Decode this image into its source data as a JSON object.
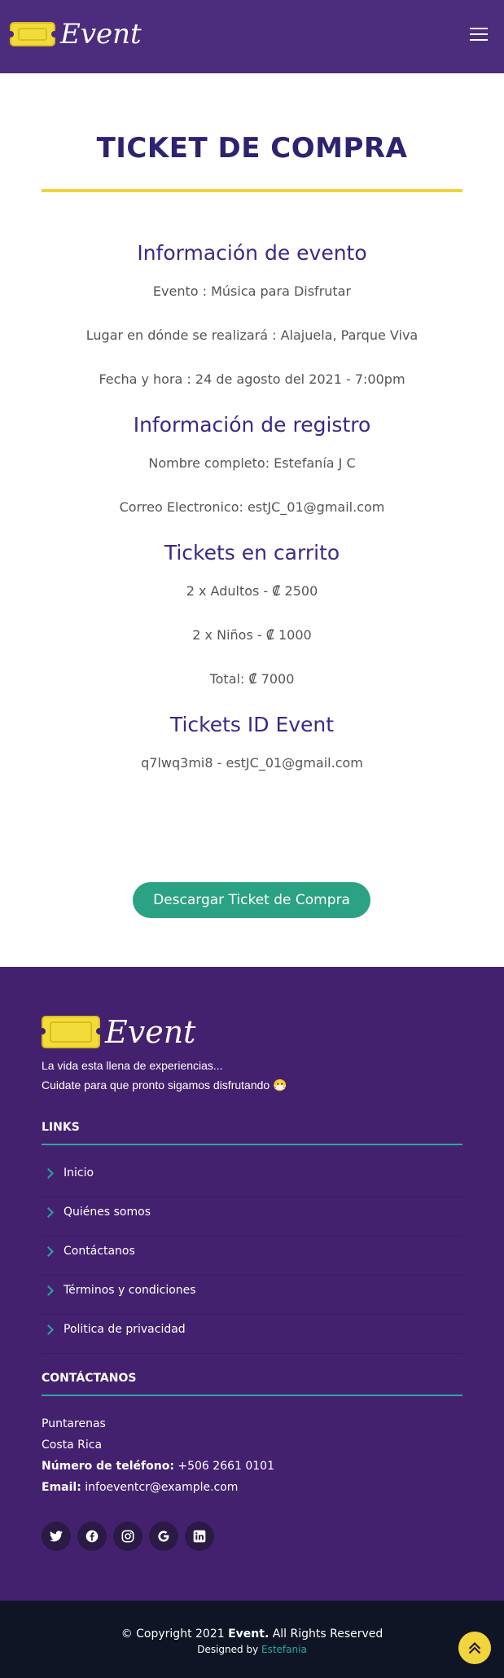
{
  "header": {
    "logo_text": "Event",
    "menu_icon": "hamburger-menu-icon"
  },
  "main": {
    "title": "TICKET DE COMPRA",
    "event_info": {
      "heading": "Información de evento",
      "event": "Evento : Música para Disfrutar",
      "place": "Lugar en dónde se realizará : Alajuela, Parque Viva",
      "datetime": "Fecha y hora : 24 de agosto del 2021 - 7:00pm"
    },
    "registration": {
      "heading": "Información de registro",
      "name": "Nombre completo: Estefanía J C",
      "email": "Correo Electronico: estJC_01@gmail.com"
    },
    "cart": {
      "heading": "Tickets en carrito",
      "adults": "2 x Adultos - ₡ 2500",
      "children": "2 x Niños - ₡ 1000",
      "total": "Total: ₡ 7000"
    },
    "ticket_id": {
      "heading": "Tickets ID Event",
      "value": "q7lwq3mi8 - estJC_01@gmail.com"
    },
    "download_button": "Descargar Ticket de Compra"
  },
  "footer": {
    "logo_text": "Event",
    "tagline_1": "La vida esta llena de experiencias...",
    "tagline_2": "Cuidate para que pronto sigamos disfrutando 😷",
    "links_heading": "LINKS",
    "links": [
      {
        "label": "Inicio"
      },
      {
        "label": "Quiénes somos"
      },
      {
        "label": "Contáctanos"
      },
      {
        "label": "Términos y condiciones"
      },
      {
        "label": "Politica de privacidad"
      }
    ],
    "contact_heading": "CONTÁCTANOS",
    "contact": {
      "city": "Puntarenas",
      "country": "Costa Rica",
      "phone_label": "Número de teléfono:",
      "phone": "+506 2661 0101",
      "email_label": "Email:",
      "email": "infoeventcr@example.com"
    },
    "socials": [
      {
        "icon": "twitter-icon",
        "glyph": "🐦"
      },
      {
        "icon": "facebook-icon",
        "glyph": "f"
      },
      {
        "icon": "instagram-icon",
        "glyph": "◎"
      },
      {
        "icon": "google-icon",
        "glyph": "G"
      },
      {
        "icon": "linkedin-icon",
        "glyph": "in"
      }
    ]
  },
  "bottom": {
    "copyright_prefix": "© Copyright 2021",
    "brand": "Event.",
    "copyright_suffix": "All Rights Reserved",
    "designed_by": "Designed by",
    "designer": "Estefania"
  },
  "colors": {
    "header_bg": "#4b2c7d",
    "accent_yellow": "#f2d43c",
    "accent_teal": "#2aa283",
    "footer_bg": "#44216f",
    "bottom_bg": "#0f1525",
    "heading_purple": "#3a2a85"
  }
}
